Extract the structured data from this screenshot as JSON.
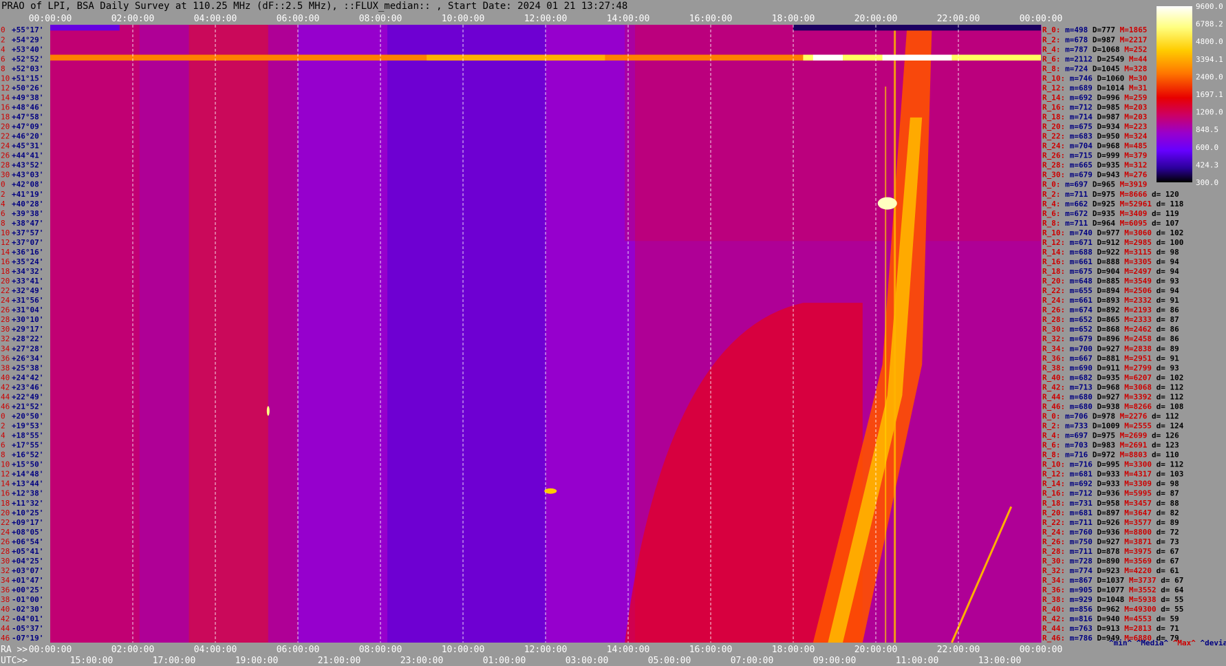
{
  "title": "PRAO of LPI, BSA Daily Survey at 110.25 MHz (dF::2.5 MHz), ::FLUX_median:: , Start Date: 2024 01 21 13:27:48",
  "colors": {
    "background": "#999999",
    "row_label": "#cc0000",
    "dec_label": "#000080",
    "min_label": "#000080",
    "max_label": "#cc0000",
    "grid": "#ffffff"
  },
  "chart_data": {
    "type": "heatmap",
    "colormap": "black-purple-red-yellow-white",
    "top_axis_ticks": [
      "00:00:00",
      "02:00:00",
      "04:00:00",
      "06:00:00",
      "08:00:00",
      "10:00:00",
      "12:00:00",
      "14:00:00",
      "16:00:00",
      "18:00:00",
      "20:00:00",
      "22:00:00",
      "00:00:00"
    ],
    "ra_axis": {
      "label": "RA >>",
      "ticks": [
        "00:00:00",
        "02:00:00",
        "04:00:00",
        "06:00:00",
        "08:00:00",
        "10:00:00",
        "12:00:00",
        "14:00:00",
        "16:00:00",
        "18:00:00",
        "20:00:00",
        "22:00:00",
        "00:00:00"
      ]
    },
    "utc_axis": {
      "label": "UTC>>",
      "ticks": [
        "15:00:00",
        "17:00:00",
        "19:00:00",
        "21:00:00",
        "23:00:00",
        "01:00:00",
        "03:00:00",
        "05:00:00",
        "07:00:00",
        "09:00:00",
        "11:00:00",
        "13:00:00"
      ]
    },
    "colorbar": {
      "ticks": [
        "9600.0",
        "6788.2",
        "4800.0",
        "3394.1",
        "2400.0",
        "1697.1",
        "1200.0",
        "848.5",
        "600.0",
        "424.3",
        "300.0"
      ]
    },
    "rows": [
      {
        "n": "0",
        "dec": "+55°17'"
      },
      {
        "n": "2",
        "dec": "+54°29'"
      },
      {
        "n": "4",
        "dec": "+53°40'"
      },
      {
        "n": "6",
        "dec": "+52°52'"
      },
      {
        "n": "8",
        "dec": "+52°03'"
      },
      {
        "n": "10",
        "dec": "+51°15'"
      },
      {
        "n": "12",
        "dec": "+50°26'"
      },
      {
        "n": "14",
        "dec": "+49°38'"
      },
      {
        "n": "16",
        "dec": "+48°46'"
      },
      {
        "n": "18",
        "dec": "+47°58'"
      },
      {
        "n": "20",
        "dec": "+47°09'"
      },
      {
        "n": "22",
        "dec": "+46°20'"
      },
      {
        "n": "24",
        "dec": "+45°31'"
      },
      {
        "n": "26",
        "dec": "+44°41'"
      },
      {
        "n": "28",
        "dec": "+43°52'"
      },
      {
        "n": "30",
        "dec": "+43°03'"
      },
      {
        "n": "0",
        "dec": "+42°08'"
      },
      {
        "n": "2",
        "dec": "+41°19'"
      },
      {
        "n": "4",
        "dec": "+40°28'"
      },
      {
        "n": "6",
        "dec": "+39°38'"
      },
      {
        "n": "8",
        "dec": "+38°47'"
      },
      {
        "n": "10",
        "dec": "+37°57'"
      },
      {
        "n": "12",
        "dec": "+37°07'"
      },
      {
        "n": "14",
        "dec": "+36°16'"
      },
      {
        "n": "16",
        "dec": "+35°24'"
      },
      {
        "n": "18",
        "dec": "+34°32'"
      },
      {
        "n": "20",
        "dec": "+33°41'"
      },
      {
        "n": "22",
        "dec": "+32°49'"
      },
      {
        "n": "24",
        "dec": "+31°56'"
      },
      {
        "n": "26",
        "dec": "+31°04'"
      },
      {
        "n": "28",
        "dec": "+30°10'"
      },
      {
        "n": "30",
        "dec": "+29°17'"
      },
      {
        "n": "32",
        "dec": "+28°22'"
      },
      {
        "n": "34",
        "dec": "+27°28'"
      },
      {
        "n": "36",
        "dec": "+26°34'"
      },
      {
        "n": "38",
        "dec": "+25°38'"
      },
      {
        "n": "40",
        "dec": "+24°42'"
      },
      {
        "n": "42",
        "dec": "+23°46'"
      },
      {
        "n": "44",
        "dec": "+22°49'"
      },
      {
        "n": "46",
        "dec": "+21°52'"
      },
      {
        "n": "0",
        "dec": "+20°50'"
      },
      {
        "n": "2",
        "dec": "+19°53'"
      },
      {
        "n": "4",
        "dec": "+18°55'"
      },
      {
        "n": "6",
        "dec": "+17°55'"
      },
      {
        "n": "8",
        "dec": "+16°52'"
      },
      {
        "n": "10",
        "dec": "+15°50'"
      },
      {
        "n": "12",
        "dec": "+14°48'"
      },
      {
        "n": "14",
        "dec": "+13°44'"
      },
      {
        "n": "16",
        "dec": "+12°38'"
      },
      {
        "n": "18",
        "dec": "+11°32'"
      },
      {
        "n": "20",
        "dec": "+10°25'"
      },
      {
        "n": "22",
        "dec": "+09°17'"
      },
      {
        "n": "24",
        "dec": "+08°05'"
      },
      {
        "n": "26",
        "dec": "+06°54'"
      },
      {
        "n": "28",
        "dec": "+05°41'"
      },
      {
        "n": "30",
        "dec": "+04°25'"
      },
      {
        "n": "32",
        "dec": "+03°07'"
      },
      {
        "n": "34",
        "dec": "+01°47'"
      },
      {
        "n": "36",
        "dec": "+00°25'"
      },
      {
        "n": "38",
        "dec": "-01°00'"
      },
      {
        "n": "40",
        "dec": "-02°30'"
      },
      {
        "n": "42",
        "dec": "-04°01'"
      },
      {
        "n": "44",
        "dec": "-05°37'"
      },
      {
        "n": "46",
        "dec": "-07°19'"
      }
    ],
    "stats": [
      {
        "r": "R_0:",
        "min": "m=498",
        "median": "D=777",
        "max": "M=1865",
        "d": ""
      },
      {
        "r": "R_2:",
        "min": "m=678",
        "median": "D=987",
        "max": "M=2217",
        "d": ""
      },
      {
        "r": "R_4:",
        "min": "m=787",
        "median": "D=1068",
        "max": "M=252",
        "d": ""
      },
      {
        "r": "R_6:",
        "min": "m=2112",
        "median": "D=2549",
        "max": "M=44",
        "d": ""
      },
      {
        "r": "R_8:",
        "min": "m=724",
        "median": "D=1045",
        "max": "M=328",
        "d": ""
      },
      {
        "r": "R_10:",
        "min": "m=746",
        "median": "D=1060",
        "max": "M=30",
        "d": ""
      },
      {
        "r": "R_12:",
        "min": "m=689",
        "median": "D=1014",
        "max": "M=31",
        "d": ""
      },
      {
        "r": "R_14:",
        "min": "m=692",
        "median": "D=996",
        "max": "M=259",
        "d": ""
      },
      {
        "r": "R_16:",
        "min": "m=712",
        "median": "D=985",
        "max": "M=203",
        "d": ""
      },
      {
        "r": "R_18:",
        "min": "m=714",
        "median": "D=987",
        "max": "M=203",
        "d": ""
      },
      {
        "r": "R_20:",
        "min": "m=675",
        "median": "D=934",
        "max": "M=223",
        "d": ""
      },
      {
        "r": "R_22:",
        "min": "m=683",
        "median": "D=950",
        "max": "M=324",
        "d": ""
      },
      {
        "r": "R_24:",
        "min": "m=704",
        "median": "D=968",
        "max": "M=485",
        "d": ""
      },
      {
        "r": "R_26:",
        "min": "m=715",
        "median": "D=999",
        "max": "M=379",
        "d": ""
      },
      {
        "r": "R_28:",
        "min": "m=665",
        "median": "D=935",
        "max": "M=312",
        "d": ""
      },
      {
        "r": "R_30:",
        "min": "m=679",
        "median": "D=943",
        "max": "M=276",
        "d": ""
      },
      {
        "r": "R_0:",
        "min": "m=697",
        "median": "D=965",
        "max": "M=3919",
        "d": ""
      },
      {
        "r": "R_2:",
        "min": "m=711",
        "median": "D=975",
        "max": "M=8666",
        "d": "d= 120"
      },
      {
        "r": "R_4:",
        "min": "m=662",
        "median": "D=925",
        "max": "M=52961",
        "d": "d= 118"
      },
      {
        "r": "R_6:",
        "min": "m=672",
        "median": "D=935",
        "max": "M=3409",
        "d": "d= 119"
      },
      {
        "r": "R_8:",
        "min": "m=711",
        "median": "D=964",
        "max": "M=6095",
        "d": "d= 107"
      },
      {
        "r": "R_10:",
        "min": "m=740",
        "median": "D=977",
        "max": "M=3060",
        "d": "d= 102"
      },
      {
        "r": "R_12:",
        "min": "m=671",
        "median": "D=912",
        "max": "M=2985",
        "d": "d= 100"
      },
      {
        "r": "R_14:",
        "min": "m=688",
        "median": "D=922",
        "max": "M=3115",
        "d": "d= 98"
      },
      {
        "r": "R_16:",
        "min": "m=661",
        "median": "D=888",
        "max": "M=3305",
        "d": "d= 94"
      },
      {
        "r": "R_18:",
        "min": "m=675",
        "median": "D=904",
        "max": "M=2497",
        "d": "d= 94"
      },
      {
        "r": "R_20:",
        "min": "m=648",
        "median": "D=885",
        "max": "M=3549",
        "d": "d= 93"
      },
      {
        "r": "R_22:",
        "min": "m=655",
        "median": "D=894",
        "max": "M=2506",
        "d": "d= 94"
      },
      {
        "r": "R_24:",
        "min": "m=661",
        "median": "D=893",
        "max": "M=2332",
        "d": "d= 91"
      },
      {
        "r": "R_26:",
        "min": "m=674",
        "median": "D=892",
        "max": "M=2193",
        "d": "d= 86"
      },
      {
        "r": "R_28:",
        "min": "m=652",
        "median": "D=865",
        "max": "M=2333",
        "d": "d= 87"
      },
      {
        "r": "R_30:",
        "min": "m=652",
        "median": "D=868",
        "max": "M=2462",
        "d": "d= 86"
      },
      {
        "r": "R_32:",
        "min": "m=679",
        "median": "D=896",
        "max": "M=2458",
        "d": "d= 86"
      },
      {
        "r": "R_34:",
        "min": "m=700",
        "median": "D=927",
        "max": "M=2838",
        "d": "d= 89"
      },
      {
        "r": "R_36:",
        "min": "m=667",
        "median": "D=881",
        "max": "M=2951",
        "d": "d= 91"
      },
      {
        "r": "R_38:",
        "min": "m=690",
        "median": "D=911",
        "max": "M=2799",
        "d": "d= 93"
      },
      {
        "r": "R_40:",
        "min": "m=682",
        "median": "D=935",
        "max": "M=6207",
        "d": "d= 102"
      },
      {
        "r": "R_42:",
        "min": "m=713",
        "median": "D=968",
        "max": "M=3068",
        "d": "d= 112"
      },
      {
        "r": "R_44:",
        "min": "m=680",
        "median": "D=927",
        "max": "M=3392",
        "d": "d= 112"
      },
      {
        "r": "R_46:",
        "min": "m=680",
        "median": "D=938",
        "max": "M=8266",
        "d": "d= 108"
      },
      {
        "r": "R_0:",
        "min": "m=706",
        "median": "D=978",
        "max": "M=2276",
        "d": "d= 112"
      },
      {
        "r": "R_2:",
        "min": "m=733",
        "median": "D=1009",
        "max": "M=2555",
        "d": "d= 124"
      },
      {
        "r": "R_4:",
        "min": "m=697",
        "median": "D=975",
        "max": "M=2699",
        "d": "d= 126"
      },
      {
        "r": "R_6:",
        "min": "m=703",
        "median": "D=983",
        "max": "M=2691",
        "d": "d= 123"
      },
      {
        "r": "R_8:",
        "min": "m=716",
        "median": "D=972",
        "max": "M=8803",
        "d": "d= 110"
      },
      {
        "r": "R_10:",
        "min": "m=716",
        "median": "D=995",
        "max": "M=3300",
        "d": "d= 112"
      },
      {
        "r": "R_12:",
        "min": "m=681",
        "median": "D=933",
        "max": "M=4317",
        "d": "d= 103"
      },
      {
        "r": "R_14:",
        "min": "m=692",
        "median": "D=933",
        "max": "M=3309",
        "d": "d= 98"
      },
      {
        "r": "R_16:",
        "min": "m=712",
        "median": "D=936",
        "max": "M=5995",
        "d": "d= 87"
      },
      {
        "r": "R_18:",
        "min": "m=731",
        "median": "D=958",
        "max": "M=3457",
        "d": "d= 88"
      },
      {
        "r": "R_20:",
        "min": "m=681",
        "median": "D=897",
        "max": "M=3647",
        "d": "d= 82"
      },
      {
        "r": "R_22:",
        "min": "m=711",
        "median": "D=926",
        "max": "M=3577",
        "d": "d= 89"
      },
      {
        "r": "R_24:",
        "min": "m=760",
        "median": "D=936",
        "max": "M=8800",
        "d": "d= 72"
      },
      {
        "r": "R_26:",
        "min": "m=750",
        "median": "D=927",
        "max": "M=3871",
        "d": "d= 73"
      },
      {
        "r": "R_28:",
        "min": "m=711",
        "median": "D=878",
        "max": "M=3975",
        "d": "d= 67"
      },
      {
        "r": "R_30:",
        "min": "m=728",
        "median": "D=890",
        "max": "M=3569",
        "d": "d= 67"
      },
      {
        "r": "R_32:",
        "min": "m=774",
        "median": "D=923",
        "max": "M=4220",
        "d": "d= 61"
      },
      {
        "r": "R_34:",
        "min": "m=867",
        "median": "D=1037",
        "max": "M=3737",
        "d": "d= 67"
      },
      {
        "r": "R_36:",
        "min": "m=905",
        "median": "D=1077",
        "max": "M=3552",
        "d": "d= 64"
      },
      {
        "r": "R_38:",
        "min": "m=929",
        "median": "D=1048",
        "max": "M=5938",
        "d": "d= 55"
      },
      {
        "r": "R_40:",
        "min": "m=856",
        "median": "D=962",
        "max": "M=49300",
        "d": "d= 55"
      },
      {
        "r": "R_42:",
        "min": "m=816",
        "median": "D=940",
        "max": "M=4553",
        "d": "d= 59"
      },
      {
        "r": "R_44:",
        "min": "m=763",
        "median": "D=913",
        "max": "M=2813",
        "d": "d= 71"
      },
      {
        "r": "R_46:",
        "min": "m=786",
        "median": "D=949",
        "max": "M=6880",
        "d": "d= 79"
      }
    ],
    "stats_footer": {
      "min": "^min^",
      "median": "^Media^",
      "max": "^Max^",
      "dev": "^devia^"
    }
  }
}
